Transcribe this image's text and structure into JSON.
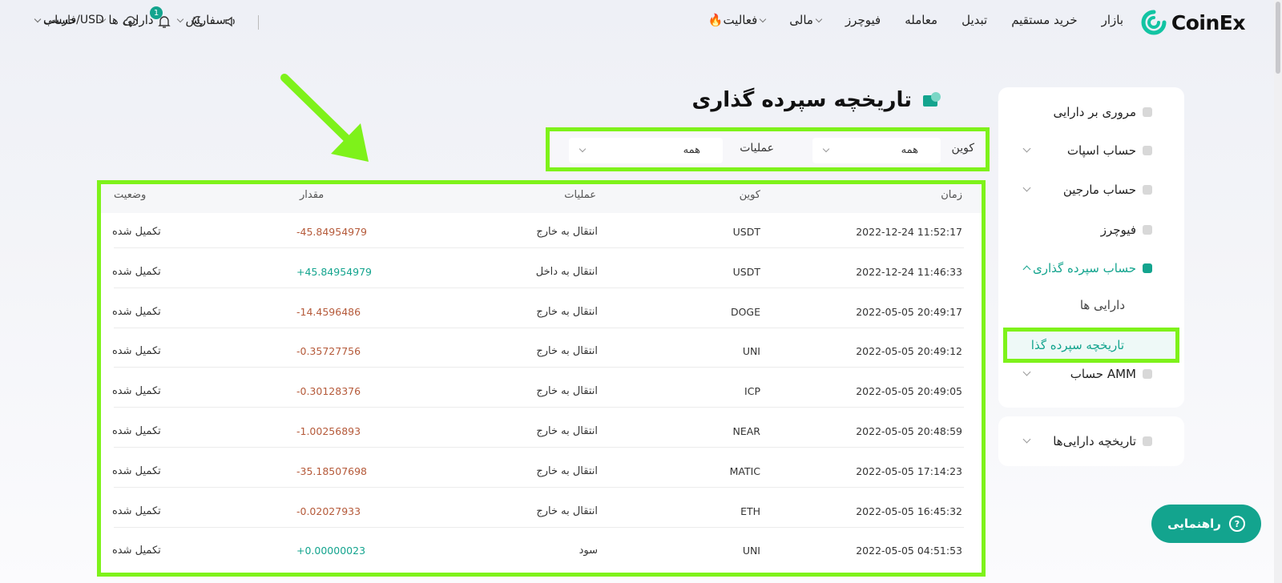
{
  "brand": {
    "name": "CoinEx"
  },
  "nav": {
    "right": [
      "بازار",
      "خرید مستقیم",
      "تبدیل",
      "معامله",
      "فیوچرز",
      "مالی",
      "🔥فعالیت"
    ],
    "left": [
      "سفارش",
      "دارایی ها",
      "حساب"
    ],
    "language": "فارسی/USD",
    "notification_count": "1"
  },
  "sidebar": {
    "items": [
      {
        "label": "مروری بر دارایی"
      },
      {
        "label": "حساب اسپات"
      },
      {
        "label": "حساب مارجین"
      },
      {
        "label": "فیوچرز"
      },
      {
        "label": "حساب سپرده گذاری"
      },
      {
        "label": "حساب AMM"
      }
    ],
    "sub_items": [
      "دارایی ها",
      "تاریخچه سپرده گذا"
    ],
    "history": "تاریخچه دارایی‌ها"
  },
  "page": {
    "title": "تاریخچه سپرده گذاری"
  },
  "filters": {
    "coin_label": "کوین",
    "coin_value": "همه",
    "operation_label": "عملیات",
    "operation_value": "همه"
  },
  "table": {
    "headers": {
      "time": "زمان",
      "coin": "کوین",
      "operation": "عملیات",
      "amount": "مقدار",
      "status": "وضعیت"
    },
    "rows": [
      {
        "time": "2022-12-24  11:52:17",
        "coin": "USDT",
        "operation": "انتقال به خارج",
        "amount": "-45.84954979",
        "status": "تکمیل شده"
      },
      {
        "time": "2022-12-24  11:46:33",
        "coin": "USDT",
        "operation": "انتقال به داخل",
        "amount": "+45.84954979",
        "status": "تکمیل شده"
      },
      {
        "time": "2022-05-05  20:49:17",
        "coin": "DOGE",
        "operation": "انتقال به خارج",
        "amount": "-14.4596486",
        "status": "تکمیل شده"
      },
      {
        "time": "2022-05-05  20:49:12",
        "coin": "UNI",
        "operation": "انتقال به خارج",
        "amount": "-0.35727756",
        "status": "تکمیل شده"
      },
      {
        "time": "2022-05-05  20:49:05",
        "coin": "ICP",
        "operation": "انتقال به خارج",
        "amount": "-0.30128376",
        "status": "تکمیل شده"
      },
      {
        "time": "2022-05-05  20:48:59",
        "coin": "NEAR",
        "operation": "انتقال به خارج",
        "amount": "-1.00256893",
        "status": "تکمیل شده"
      },
      {
        "time": "2022-05-05  17:14:23",
        "coin": "MATIC",
        "operation": "انتقال به خارج",
        "amount": "-35.18507698",
        "status": "تکمیل شده"
      },
      {
        "time": "2022-05-05  16:45:32",
        "coin": "ETH",
        "operation": "انتقال به خارج",
        "amount": "-0.02027933",
        "status": "تکمیل شده"
      },
      {
        "time": "2022-05-05  04:51:53",
        "coin": "UNI",
        "operation": "سود",
        "amount": "+0.00000023",
        "status": "تکمیل شده"
      }
    ]
  },
  "help": {
    "label": "راهنمایی"
  },
  "colors": {
    "accent": "#13a48e",
    "highlight": "#7ef21a",
    "negative": "#b55a3a"
  }
}
